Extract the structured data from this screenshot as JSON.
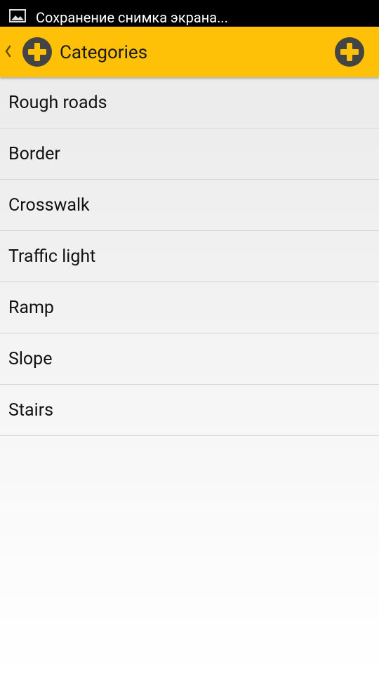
{
  "status_bar": {
    "notification_icon": "image-icon",
    "notification_text": "Сохранение снимка экрана..."
  },
  "action_bar": {
    "back_icon": "chevron-left-icon",
    "app_icon": "plus-circle-icon",
    "title": "Categories",
    "add_icon": "plus-circle-icon",
    "accent_color": "#ffc107"
  },
  "categories": [
    {
      "label": "Rough roads"
    },
    {
      "label": "Border"
    },
    {
      "label": "Crosswalk"
    },
    {
      "label": "Traffic light"
    },
    {
      "label": "Ramp"
    },
    {
      "label": "Slope"
    },
    {
      "label": "Stairs"
    }
  ]
}
